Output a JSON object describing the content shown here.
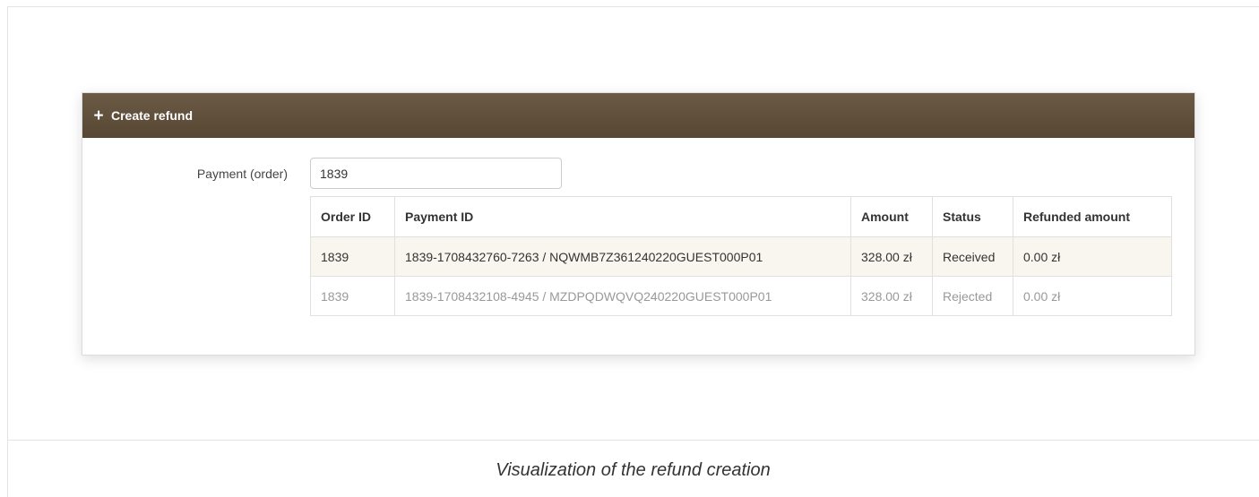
{
  "panel": {
    "header": {
      "icon": "plus-icon",
      "title": "Create refund"
    },
    "form": {
      "payment_label": "Payment (order)",
      "payment_value": "1839"
    },
    "table": {
      "columns": [
        "Order ID",
        "Payment ID",
        "Amount",
        "Status",
        "Refunded amount"
      ],
      "rows": [
        {
          "order_id": "1839",
          "payment_id": "1839-1708432760-7263 / NQWMB7Z361240220GUEST000P01",
          "amount": "328.00 zł",
          "status": "Received",
          "refunded_amount": "0.00 zł"
        },
        {
          "order_id": "1839",
          "payment_id": "1839-1708432108-4945 / MZDPQDWQVQ240220GUEST000P01",
          "amount": "328.00 zł",
          "status": "Rejected",
          "refunded_amount": "0.00 zł"
        }
      ]
    }
  },
  "caption": "Visualization of the refund creation",
  "colors": {
    "header_bg": "#5f4f3b",
    "selected_row_bg": "#f9f6f0",
    "muted_text": "#999999"
  }
}
